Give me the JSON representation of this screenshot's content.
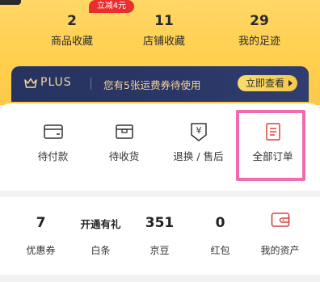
{
  "stats": [
    {
      "value": "2",
      "label": "商品收藏"
    },
    {
      "value": "11",
      "label": "店铺收藏"
    },
    {
      "value": "29",
      "label": "我的足迹"
    }
  ],
  "plus_banner": {
    "brand": "PLUS",
    "text": "您有5张运费券待使用",
    "button": "立即查看"
  },
  "orders": [
    {
      "label": "待付款",
      "icon": "wallet-card-icon"
    },
    {
      "label": "待收货",
      "icon": "package-icon"
    },
    {
      "label": "退换 / 售后",
      "icon": "refund-icon"
    },
    {
      "label": "全部订单",
      "icon": "order-list-icon"
    }
  ],
  "assets": {
    "badge": "立减4元",
    "items": [
      {
        "value": "7",
        "label": "优惠券"
      },
      {
        "value": "开通有礼",
        "label": "白条"
      },
      {
        "value": "351",
        "label": "京豆"
      },
      {
        "value": "0",
        "label": "红包"
      },
      {
        "value": "",
        "label": "我的资产"
      }
    ]
  },
  "colors": {
    "header_yellow": "#ffd45c",
    "plus_navy": "#28345f",
    "plus_gold": "#f6d7a0",
    "highlight_pink": "#f06bb0",
    "badge_red": "#ea2d2d",
    "icon_red": "#d8423f"
  }
}
